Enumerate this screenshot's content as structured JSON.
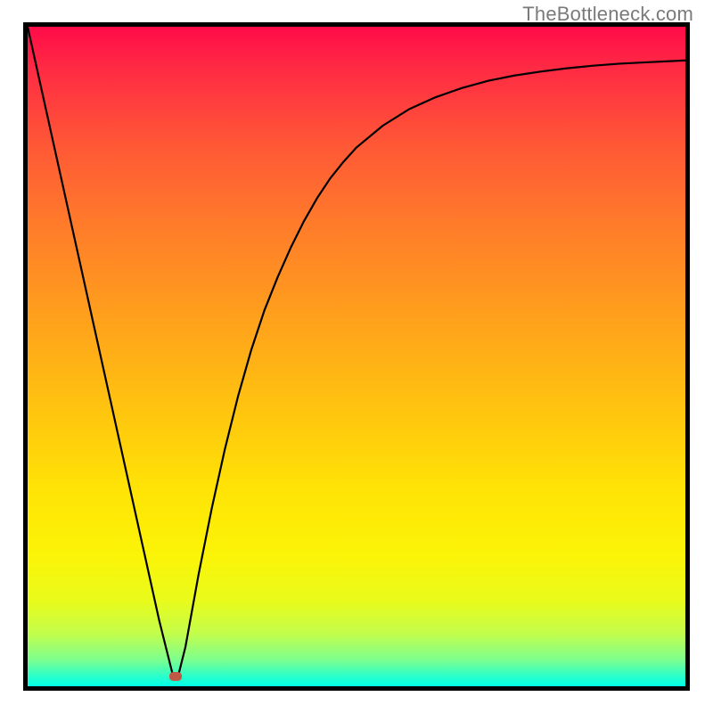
{
  "watermark": "TheBottleneck.com",
  "colors": {
    "frame_border": "#000000",
    "curve_stroke": "#000000",
    "marker_fill": "#c15a45",
    "gradient_top": "#ff0b48",
    "gradient_bottom": "#00ffe9"
  },
  "chart_data": {
    "type": "line",
    "title": "",
    "xlabel": "",
    "ylabel": "",
    "xlim": [
      0,
      100
    ],
    "ylim": [
      0,
      100
    ],
    "annotations": [
      {
        "name": "marker",
        "x": 22.5,
        "y": 1.5
      }
    ],
    "series": [
      {
        "name": "bottleneck-curve",
        "x": [
          0,
          2,
          4,
          6,
          8,
          10,
          12,
          14,
          16,
          18,
          20,
          21,
          22,
          23,
          24,
          26,
          28,
          30,
          32,
          34,
          36,
          38,
          40,
          42,
          44,
          46,
          48,
          50,
          54,
          58,
          62,
          66,
          70,
          74,
          78,
          82,
          86,
          90,
          94,
          98,
          100
        ],
        "y": [
          100,
          91,
          82,
          73,
          64,
          55,
          46,
          37,
          28,
          19,
          10,
          6,
          2,
          2,
          6,
          17,
          27,
          36,
          44,
          51,
          57,
          62,
          66.5,
          70.5,
          74,
          77,
          79.5,
          81.7,
          85,
          87.5,
          89.3,
          90.7,
          91.8,
          92.6,
          93.2,
          93.7,
          94.1,
          94.4,
          94.6,
          94.8,
          94.9
        ]
      }
    ]
  }
}
